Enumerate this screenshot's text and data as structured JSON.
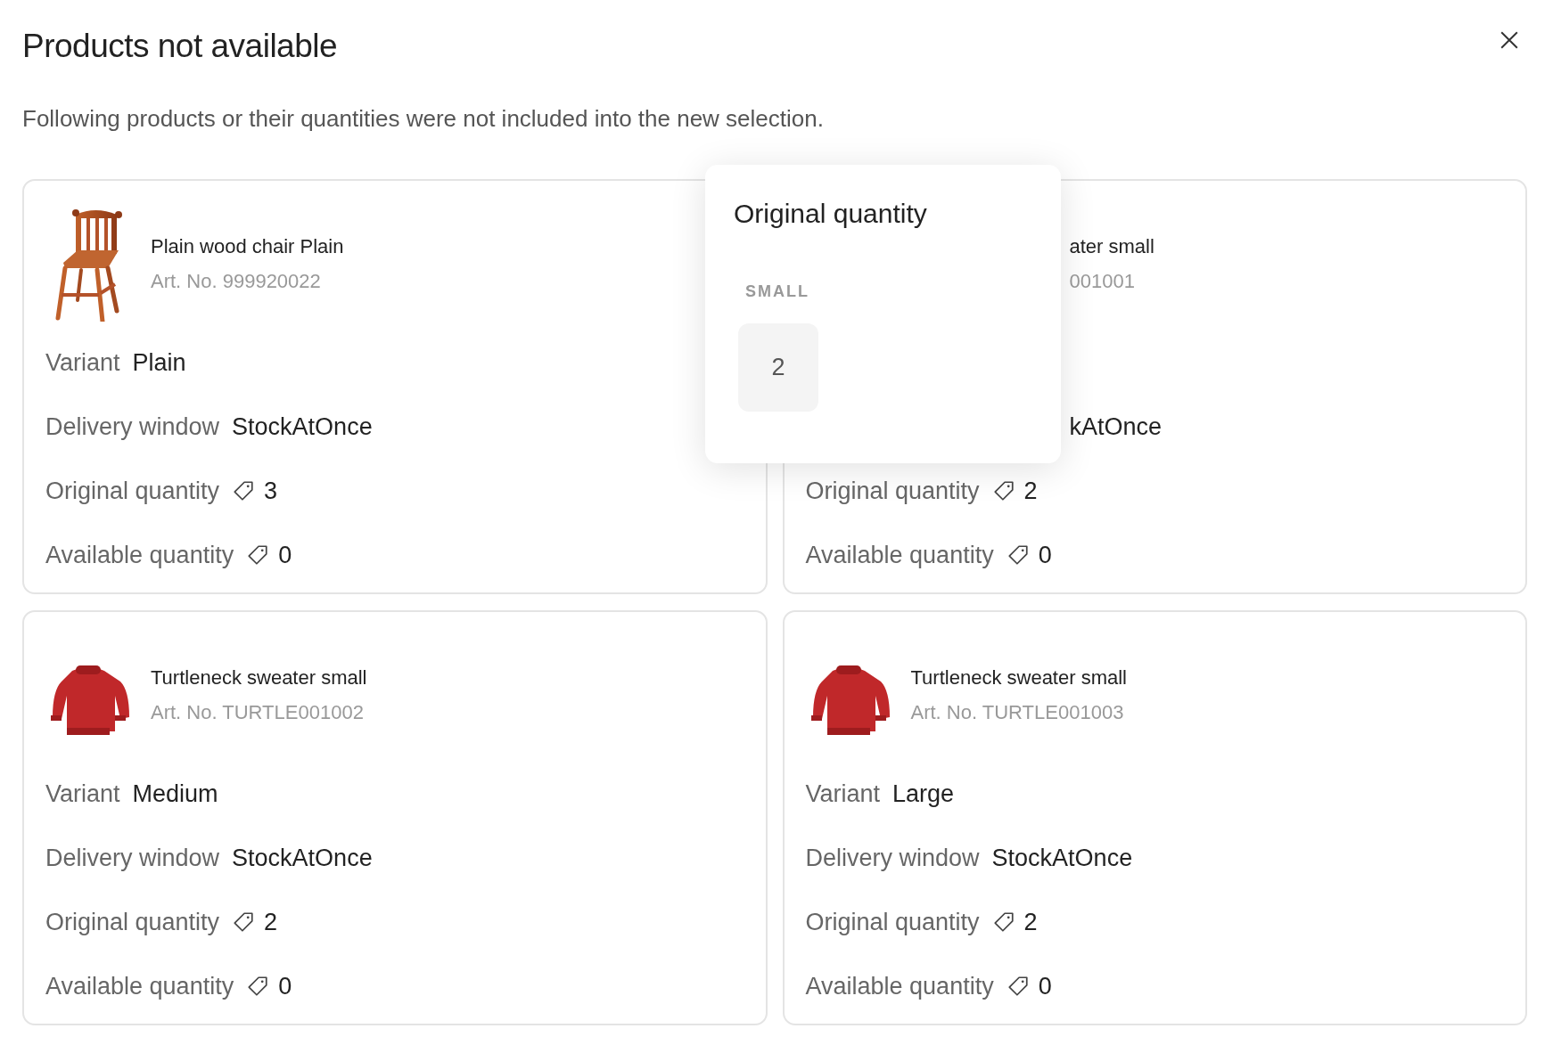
{
  "dialog": {
    "title": "Products not available",
    "message": "Following products or their quantities were not included into the new selection."
  },
  "products": [
    {
      "name": "Plain wood chair Plain",
      "art_no": "Art. No. 999920022",
      "rows": [
        {
          "kind": "text",
          "label": "Variant",
          "value": "Plain"
        },
        {
          "kind": "text",
          "label": "Delivery window",
          "value": "StockAtOnce"
        },
        {
          "kind": "quantity",
          "label": "Original quantity",
          "value": "3"
        },
        {
          "kind": "quantity",
          "label": "Available quantity",
          "value": "0"
        }
      ]
    },
    {
      "name": "ater small",
      "art_no": "001001",
      "rows": [
        {
          "kind": "text",
          "value": "kAtOnce"
        },
        {
          "kind": "quantity",
          "label": "Original quantity",
          "value": "2"
        },
        {
          "kind": "quantity",
          "label": "Available quantity",
          "value": "0"
        }
      ]
    },
    {
      "name": "Turtleneck sweater small",
      "art_no": "Art. No. TURTLE001002",
      "rows": [
        {
          "kind": "text",
          "label": "Variant",
          "value": "Medium"
        },
        {
          "kind": "text",
          "label": "Delivery window",
          "value": "StockAtOnce"
        },
        {
          "kind": "quantity",
          "label": "Original quantity",
          "value": "2"
        },
        {
          "kind": "quantity",
          "label": "Available quantity",
          "value": "0"
        }
      ]
    },
    {
      "name": "Turtleneck sweater small",
      "art_no": "Art. No. TURTLE001003",
      "rows": [
        {
          "kind": "text",
          "label": "Variant",
          "value": "Large"
        },
        {
          "kind": "text",
          "label": "Delivery window",
          "value": "StockAtOnce"
        },
        {
          "kind": "quantity",
          "label": "Original quantity",
          "value": "2"
        },
        {
          "kind": "quantity",
          "label": "Available quantity",
          "value": "0"
        }
      ]
    }
  ],
  "popover": {
    "title": "Original quantity",
    "sizes": [
      {
        "label": "SMALL",
        "value": "2"
      }
    ]
  }
}
